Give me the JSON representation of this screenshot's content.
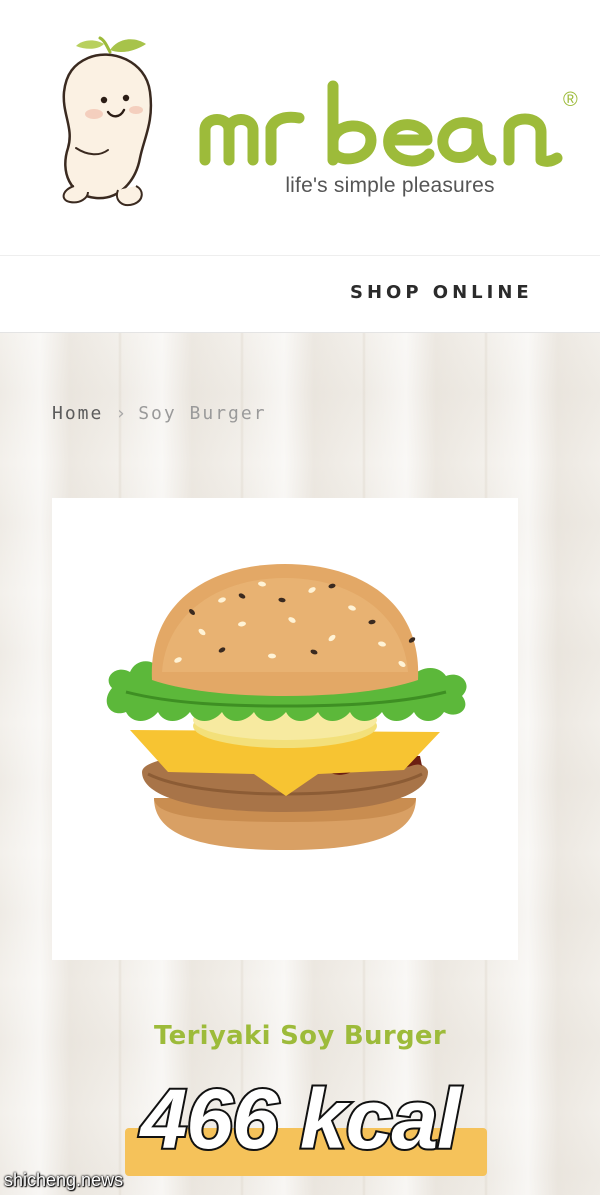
{
  "header": {
    "brand_name": "mr bean",
    "registered_mark": "®",
    "tagline": "life's simple pleasures",
    "brand_color": "#9dbb3a"
  },
  "nav": {
    "shop_online_label": "SHOP ONLINE"
  },
  "breadcrumb": {
    "home": "Home",
    "separator": "›",
    "current": "Soy Burger"
  },
  "product": {
    "image_icon": "burger-image",
    "name": "Teriyaki Soy Burger",
    "calories": "466 kcal",
    "calorie_highlight_color": "#f5c25a"
  },
  "watermark": {
    "text": "shicheng.news"
  }
}
